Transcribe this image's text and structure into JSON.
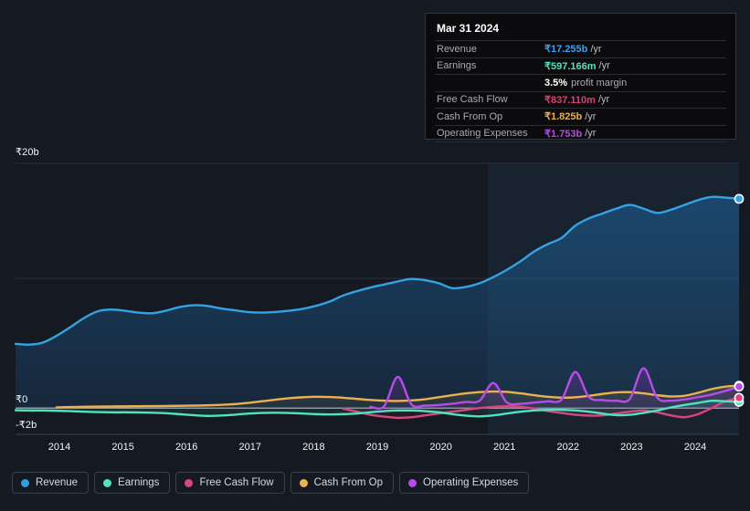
{
  "chart_data": {
    "type": "area",
    "title": "",
    "xlabel": "",
    "ylabel": "",
    "currency": "₹",
    "ylim": [
      -2000000000,
      20000000000
    ],
    "y_ticks": [
      {
        "value": 20000000000,
        "label": "₹20b"
      },
      {
        "value": 0,
        "label": "₹0"
      },
      {
        "value": -2000000000,
        "label": "-₹2b"
      }
    ],
    "gridlines": [
      20000000000,
      10000000000,
      0
    ],
    "grid": true,
    "legend_position": "bottom",
    "x_ticks": [
      "2014",
      "2015",
      "2016",
      "2017",
      "2018",
      "2019",
      "2020",
      "2021",
      "2022",
      "2023",
      "2024"
    ],
    "x_range": [
      "2013.5",
      "2024.5"
    ],
    "highlight_band": {
      "from": "2023.1",
      "to": "2024.5"
    },
    "series": [
      {
        "name": "Revenue",
        "color": "#33a3e3",
        "fill": "rgba(30,100,160,0.55)",
        "values": [
          5.25,
          5.18,
          5.35,
          5.9,
          6.6,
          7.35,
          7.9,
          8.05,
          7.95,
          7.8,
          7.75,
          7.95,
          8.25,
          8.4,
          8.35,
          8.15,
          8.0,
          7.85,
          7.8,
          7.85,
          7.95,
          8.1,
          8.35,
          8.7,
          9.2,
          9.55,
          9.85,
          10.1,
          10.35,
          10.55,
          10.45,
          10.2,
          9.8,
          9.9,
          10.2,
          10.7,
          11.3,
          12.0,
          12.8,
          13.4,
          13.9,
          14.9,
          15.5,
          15.9,
          16.3,
          16.6,
          16.3,
          15.95,
          16.2,
          16.6,
          17.0,
          17.255,
          17.2,
          17.1
        ]
      },
      {
        "name": "Earnings",
        "color": "#4fe3c1",
        "fill": "rgba(60,160,150,0.22)",
        "values": [
          -0.18,
          -0.2,
          -0.2,
          -0.22,
          -0.25,
          -0.3,
          -0.33,
          -0.35,
          -0.35,
          -0.36,
          -0.38,
          -0.42,
          -0.5,
          -0.58,
          -0.64,
          -0.62,
          -0.55,
          -0.46,
          -0.4,
          -0.38,
          -0.4,
          -0.45,
          -0.5,
          -0.52,
          -0.5,
          -0.45,
          -0.35,
          -0.25,
          -0.2,
          -0.2,
          -0.25,
          -0.35,
          -0.5,
          -0.62,
          -0.68,
          -0.6,
          -0.45,
          -0.3,
          -0.2,
          -0.15,
          -0.15,
          -0.2,
          -0.3,
          -0.45,
          -0.58,
          -0.55,
          -0.4,
          -0.2,
          0.05,
          0.25,
          0.42,
          0.597,
          0.55,
          0.5
        ]
      },
      {
        "name": "Free Cash Flow",
        "color": "#d9467f",
        "fill": "rgba(180,55,100,0.22)",
        "values": [
          null,
          null,
          null,
          null,
          null,
          null,
          null,
          null,
          null,
          null,
          null,
          null,
          null,
          null,
          null,
          null,
          null,
          null,
          null,
          null,
          null,
          null,
          null,
          null,
          -0.05,
          -0.3,
          -0.55,
          -0.7,
          -0.8,
          -0.75,
          -0.6,
          -0.45,
          -0.3,
          -0.15,
          0.0,
          0.1,
          0.15,
          0.1,
          -0.05,
          -0.25,
          -0.4,
          -0.55,
          -0.62,
          -0.6,
          -0.45,
          -0.3,
          -0.2,
          -0.35,
          -0.6,
          -0.75,
          -0.5,
          0.0,
          0.55,
          0.837
        ]
      },
      {
        "name": "Cash From Op",
        "color": "#eab052",
        "fill": "rgba(120,110,80,0.35)",
        "values": [
          null,
          null,
          null,
          0.05,
          0.08,
          0.1,
          0.12,
          0.13,
          0.14,
          0.15,
          0.16,
          0.17,
          0.18,
          0.2,
          0.22,
          0.26,
          0.32,
          0.42,
          0.55,
          0.68,
          0.8,
          0.88,
          0.92,
          0.9,
          0.84,
          0.75,
          0.66,
          0.6,
          0.58,
          0.62,
          0.72,
          0.88,
          1.05,
          1.2,
          1.3,
          1.35,
          1.32,
          1.2,
          1.05,
          0.92,
          0.85,
          0.88,
          1.0,
          1.15,
          1.28,
          1.3,
          1.2,
          1.05,
          0.95,
          1.0,
          1.25,
          1.55,
          1.75,
          1.825
        ]
      },
      {
        "name": "Operating Expenses",
        "color": "#b84ce8",
        "fill": "rgba(95,50,140,0.55)",
        "values": [
          null,
          null,
          null,
          null,
          null,
          null,
          null,
          null,
          null,
          null,
          null,
          null,
          null,
          null,
          null,
          null,
          null,
          null,
          null,
          null,
          null,
          null,
          null,
          null,
          null,
          null,
          0.1,
          0.15,
          2.55,
          0.3,
          0.2,
          0.25,
          0.35,
          0.5,
          0.6,
          2.05,
          0.45,
          0.35,
          0.45,
          0.55,
          0.7,
          2.95,
          0.9,
          0.65,
          0.6,
          0.75,
          3.25,
          0.85,
          0.6,
          0.7,
          0.9,
          1.1,
          1.4,
          1.753
        ]
      }
    ]
  },
  "tooltip": {
    "date": "Mar 31 2024",
    "rows": [
      {
        "name": "Revenue",
        "value": "₹17.255b",
        "unit": "/yr",
        "color": "#3c9ff0"
      },
      {
        "name": "Earnings",
        "value": "₹597.166m",
        "unit": "/yr",
        "color": "#4fe3c1"
      },
      {
        "name": "",
        "sub_value": "3.5%",
        "sub_text": "profit margin",
        "is_sub": true
      },
      {
        "name": "Free Cash Flow",
        "value": "₹837.110m",
        "unit": "/yr",
        "color": "#e04070"
      },
      {
        "name": "Cash From Op",
        "value": "₹1.825b",
        "unit": "/yr",
        "color": "#eab052"
      },
      {
        "name": "Operating Expenses",
        "value": "₹1.753b",
        "unit": "/yr",
        "color": "#b84ce8"
      }
    ]
  },
  "legend": {
    "items": [
      {
        "label": "Revenue",
        "color": "#2e9fe0"
      },
      {
        "label": "Earnings",
        "color": "#4fe3c1"
      },
      {
        "label": "Free Cash Flow",
        "color": "#d9467f"
      },
      {
        "label": "Cash From Op",
        "color": "#eab052"
      },
      {
        "label": "Operating Expenses",
        "color": "#b84ce8"
      }
    ]
  },
  "axis": {
    "y_top": "₹20b",
    "y_zero": "₹0",
    "y_neg": "-₹2b",
    "x": [
      "2014",
      "2015",
      "2016",
      "2017",
      "2018",
      "2019",
      "2020",
      "2021",
      "2022",
      "2023",
      "2024"
    ]
  }
}
